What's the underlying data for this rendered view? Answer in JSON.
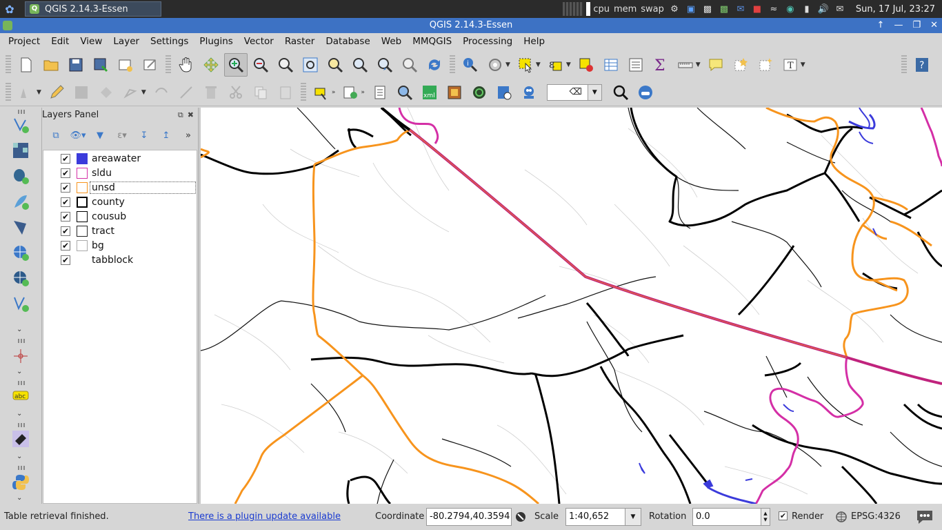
{
  "taskbar": {
    "window_button": "QGIS 2.14.3-Essen",
    "cpu": "cpu",
    "mem": "mem",
    "swap": "swap",
    "clock": "Sun, 17 Jul, 23:27"
  },
  "window": {
    "title": "QGIS 2.14.3-Essen"
  },
  "menu": [
    "Project",
    "Edit",
    "View",
    "Layer",
    "Settings",
    "Plugins",
    "Vector",
    "Raster",
    "Database",
    "Web",
    "MMQGIS",
    "Processing",
    "Help"
  ],
  "layers_panel": {
    "title": "Layers Panel",
    "layers": [
      {
        "name": "areawater",
        "checked": true,
        "swatch": "fill",
        "color": "#3b3bdb"
      },
      {
        "name": "sldu",
        "checked": true,
        "swatch": "outline",
        "color": "#d42fa6"
      },
      {
        "name": "unsd",
        "checked": true,
        "swatch": "outline",
        "color": "#f7941d"
      },
      {
        "name": "county",
        "checked": true,
        "swatch": "outline-thick",
        "color": "#000000"
      },
      {
        "name": "cousub",
        "checked": true,
        "swatch": "outline",
        "color": "#000000"
      },
      {
        "name": "tract",
        "checked": true,
        "swatch": "outline",
        "color": "#222222"
      },
      {
        "name": "bg",
        "checked": true,
        "swatch": "outline-light",
        "color": "#aaaaaa"
      },
      {
        "name": "tabblock",
        "checked": true,
        "swatch": "none",
        "color": "#ffffff"
      }
    ]
  },
  "toolbar": {
    "label_combo": "⌫"
  },
  "statusbar": {
    "message": "Table retrieval finished.",
    "plugin_link": "There is a plugin update available",
    "coordinate_label": "Coordinate",
    "coordinate_value": "-80.2794,40.3594",
    "scale_label": "Scale",
    "scale_value": "1:40,652",
    "rotation_label": "Rotation",
    "rotation_value": "0.0",
    "render_label": "Render",
    "render_checked": true,
    "crs": "EPSG:4326"
  },
  "colors": {
    "sldu": "#d42fa6",
    "unsd": "#f7941d",
    "areawater": "#3b3bdb",
    "sldu_unsd_overlap": "#c0237d"
  }
}
